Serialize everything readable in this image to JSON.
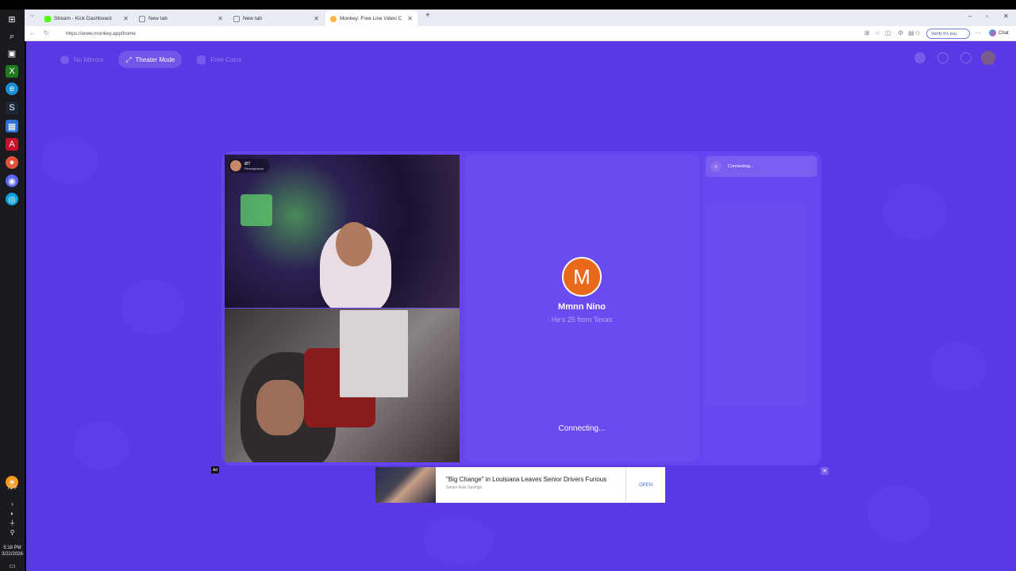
{
  "browser": {
    "tabs": [
      {
        "label": "Stream - Kick Dashboard",
        "favicon_color": "#53fc18"
      },
      {
        "label": "New tab",
        "favicon_color": "#3b6fd8"
      },
      {
        "label": "New tab",
        "favicon_color": "#3b6fd8"
      },
      {
        "label": "Monkey: Free Live Video Chat",
        "favicon_color": "#ffb347"
      }
    ],
    "new_tab_symbol": "+",
    "url": "https://www.monkey.app/home",
    "verify_label": "Verify it's you",
    "chat_label": "Chat"
  },
  "page": {
    "nav": {
      "no_mirrors": "No Mirrors",
      "theater_mode": "Theater Mode",
      "free_coins": "Free Coins"
    },
    "self_video": {
      "name": "ØT",
      "location": "Pennsylvania"
    },
    "match": {
      "initial": "M",
      "name": "Mmnn Nino",
      "subtitle": "He's 25 from Texas",
      "status": "Connecting..."
    },
    "side_panel": {
      "status": "Connecting..."
    },
    "ad": {
      "label": "Ad",
      "title": "\"Big Change\" in Louisiana Leaves Senior Drivers Furious",
      "sponsor": "Senior Auto Savings",
      "cta": "OPEN",
      "close": "✕"
    }
  },
  "taskbar": {
    "weather": "71°F",
    "time": "5:18 PM",
    "date": "3/22/2026"
  },
  "colors": {
    "page_bg": "#5b38e6",
    "avatar_bg": "#e8691b"
  }
}
